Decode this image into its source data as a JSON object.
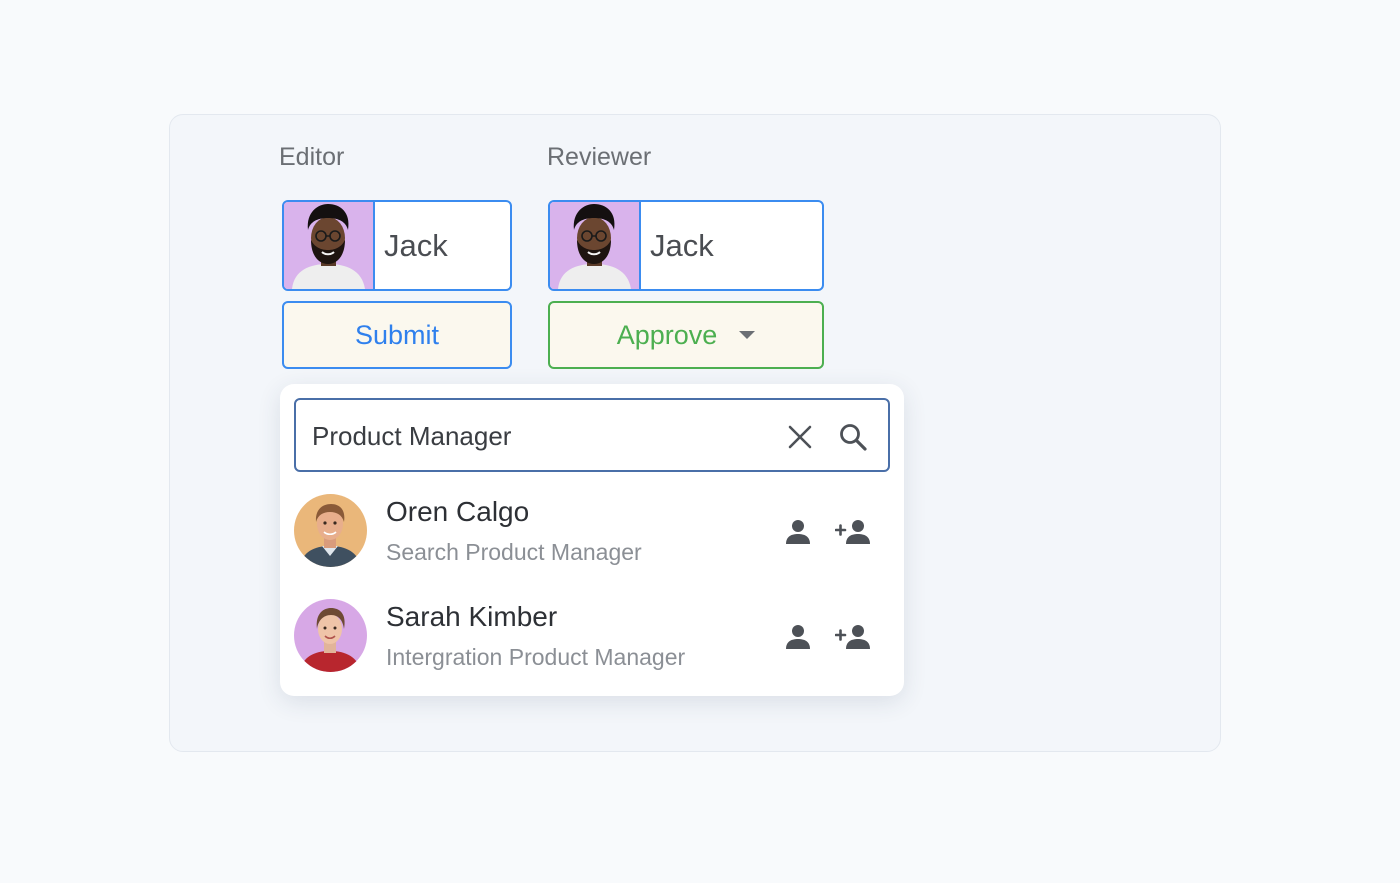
{
  "editor": {
    "label": "Editor",
    "user_name": "Jack",
    "action_label": "Submit"
  },
  "reviewer": {
    "label": "Reviewer",
    "user_name": "Jack",
    "action_label": "Approve"
  },
  "search": {
    "value": "Product Manager"
  },
  "results": [
    {
      "name": "Oren Calgo",
      "role": "Search Product Manager"
    },
    {
      "name": "Sarah Kimber",
      "role": "Intergration Product Manager"
    }
  ],
  "colors": {
    "primary_blue": "#3b8cf0",
    "approve_green": "#4caf50",
    "avatar_bg_purple": "#d9b3ec",
    "button_bg": "#fbf8ee"
  }
}
